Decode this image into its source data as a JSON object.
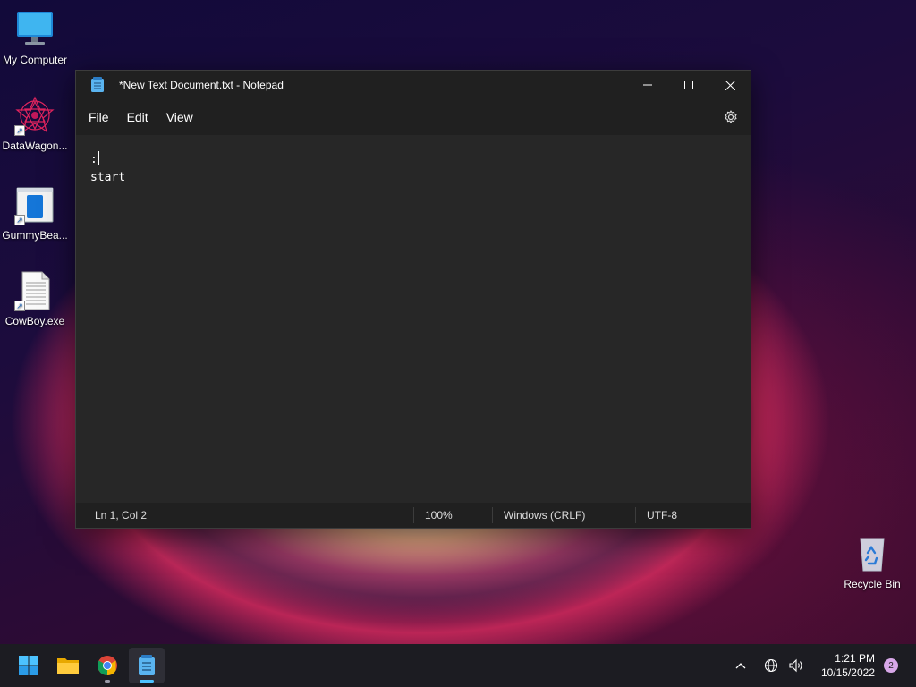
{
  "desktop": {
    "icons": [
      {
        "label": "My Computer",
        "icon": "monitor-icon"
      },
      {
        "label": "DataWagon...",
        "icon": "datawagon-icon"
      },
      {
        "label": "GummyBea...",
        "icon": "gummybear-app-icon"
      },
      {
        "label": "CowBoy.exe",
        "icon": "document-icon"
      }
    ],
    "recycle_bin": {
      "label": "Recycle Bin",
      "icon": "recycle-bin-icon"
    }
  },
  "notepad": {
    "title": "*New Text Document.txt - Notepad",
    "menu": [
      "File",
      "Edit",
      "View"
    ],
    "content_lines": [
      ":",
      "start"
    ],
    "status": {
      "position": "Ln 1, Col 2",
      "zoom": "100%",
      "line_ending": "Windows (CRLF)",
      "encoding": "UTF-8"
    }
  },
  "taskbar": {
    "apps": [
      "start-icon",
      "file-explorer-icon",
      "chrome-icon",
      "notepad-icon"
    ],
    "clock": {
      "time": "1:21 PM",
      "date": "10/15/2022"
    },
    "notification_count": "2"
  },
  "colors": {
    "accent": "#4cc2ff",
    "notepad_blue": "#5ab4f0",
    "badge": "#d7a7e8"
  }
}
